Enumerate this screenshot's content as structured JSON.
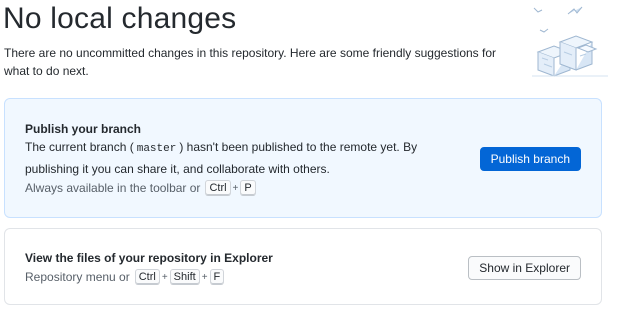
{
  "header": {
    "title": "No local changes",
    "subtitle": "There are no uncommitted changes in this repository. Here are some friendly suggestions for what to do next."
  },
  "publish_card": {
    "title": "Publish your branch",
    "desc_pre": "The current branch (",
    "branch": "master",
    "desc_post": ") hasn't been published to the remote yet. By publishing it you can share it, and collaborate with others.",
    "hint": "Always available in the toolbar or",
    "shortcut": [
      "Ctrl",
      "P"
    ],
    "button": "Publish branch"
  },
  "explorer_card": {
    "title": "View the files of your repository in Explorer",
    "hint": "Repository menu or",
    "shortcut": [
      "Ctrl",
      "Shift",
      "F"
    ],
    "button": "Show in Explorer"
  },
  "colors": {
    "accent": "#0366d6",
    "highlight_bg": "#f1f8ff",
    "highlight_border": "#c8e1ff"
  },
  "icons": {
    "illustration": "empty-state-illustration"
  }
}
